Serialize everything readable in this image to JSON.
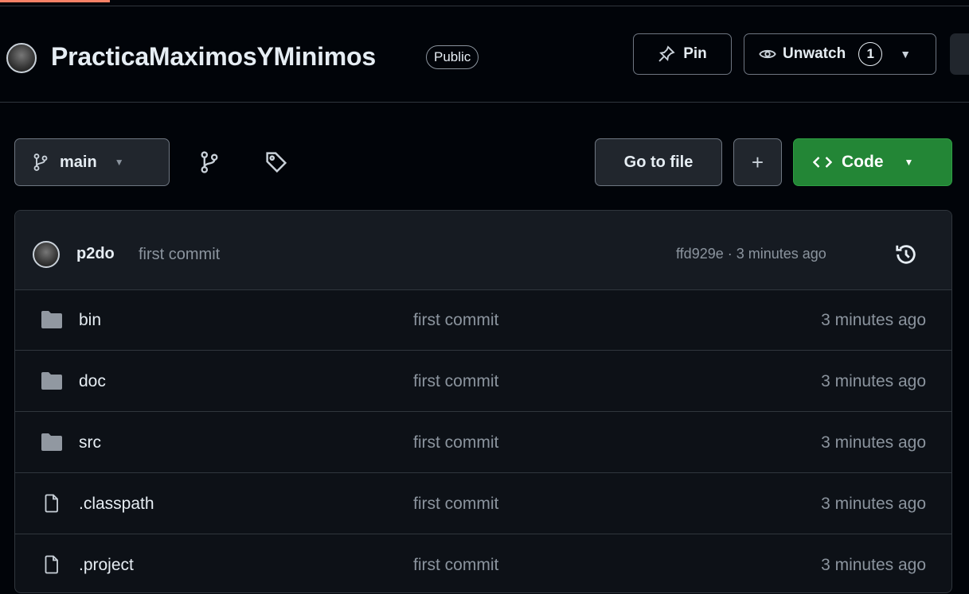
{
  "repo": {
    "name": "PracticaMaximosYMinimos",
    "visibility": "Public",
    "pin_label": "Pin",
    "unwatch_label": "Unwatch",
    "watch_count": "1"
  },
  "toolbar": {
    "branch": "main",
    "go_to_file": "Go to file",
    "add": "+",
    "code": "Code"
  },
  "latest_commit": {
    "author": "p2do",
    "message": "first commit",
    "meta": "ffd929e · 3 minutes ago"
  },
  "files": [
    {
      "name": "bin",
      "type": "folder",
      "commit": "first commit",
      "time": "3 minutes ago"
    },
    {
      "name": "doc",
      "type": "folder",
      "commit": "first commit",
      "time": "3 minutes ago"
    },
    {
      "name": "src",
      "type": "folder",
      "commit": "first commit",
      "time": "3 minutes ago"
    },
    {
      "name": ".classpath",
      "type": "file",
      "commit": "first commit",
      "time": "3 minutes ago"
    },
    {
      "name": ".project",
      "type": "file",
      "commit": "first commit",
      "time": "3 minutes ago"
    }
  ],
  "colors": {
    "background": "#010409",
    "code_button": "#238636",
    "accent": "#f78166"
  },
  "icons": {
    "branch": "git-branch-icon",
    "tag": "tag-icon",
    "pin": "pin-icon",
    "eye": "eye-icon",
    "history": "history-icon",
    "folder": "folder-icon",
    "file": "file-icon",
    "code": "code-icon"
  }
}
